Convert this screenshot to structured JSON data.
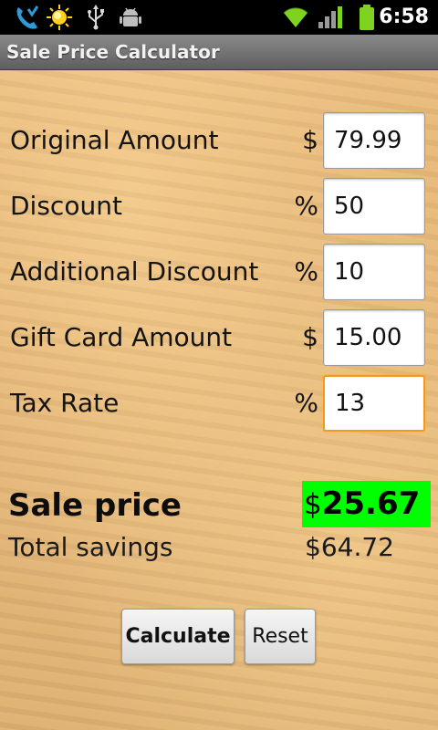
{
  "status_bar": {
    "time": "6:58",
    "icons": [
      "missed-call-icon",
      "weather-sun-icon",
      "usb-icon",
      "android-debug-icon",
      "wifi-icon",
      "signal-icon",
      "battery-icon"
    ],
    "colors": {
      "wifi": "#7fd320",
      "signal": "#7fd320",
      "battery": "#7fd320",
      "call": "#2e9bd6",
      "sun": "#ffd21a"
    }
  },
  "app": {
    "title": "Sale Price Calculator"
  },
  "form": {
    "rows": [
      {
        "label": "Original Amount",
        "unit": "$",
        "value": "79.99"
      },
      {
        "label": "Discount",
        "unit": "%",
        "value": "50"
      },
      {
        "label": "Additional Discount",
        "unit": "%",
        "value": "10"
      },
      {
        "label": "Gift Card Amount",
        "unit": "$",
        "value": "15.00"
      },
      {
        "label": "Tax Rate",
        "unit": "%",
        "value": "13"
      }
    ]
  },
  "results": {
    "sale_price_label": "Sale price",
    "sale_price_currency": "$",
    "sale_price_value": "25.67",
    "total_savings_label": "Total savings",
    "total_savings_value": "$64.72",
    "highlight_color": "#00ff00"
  },
  "buttons": {
    "calculate_label": "Calculate",
    "reset_label": "Reset"
  }
}
